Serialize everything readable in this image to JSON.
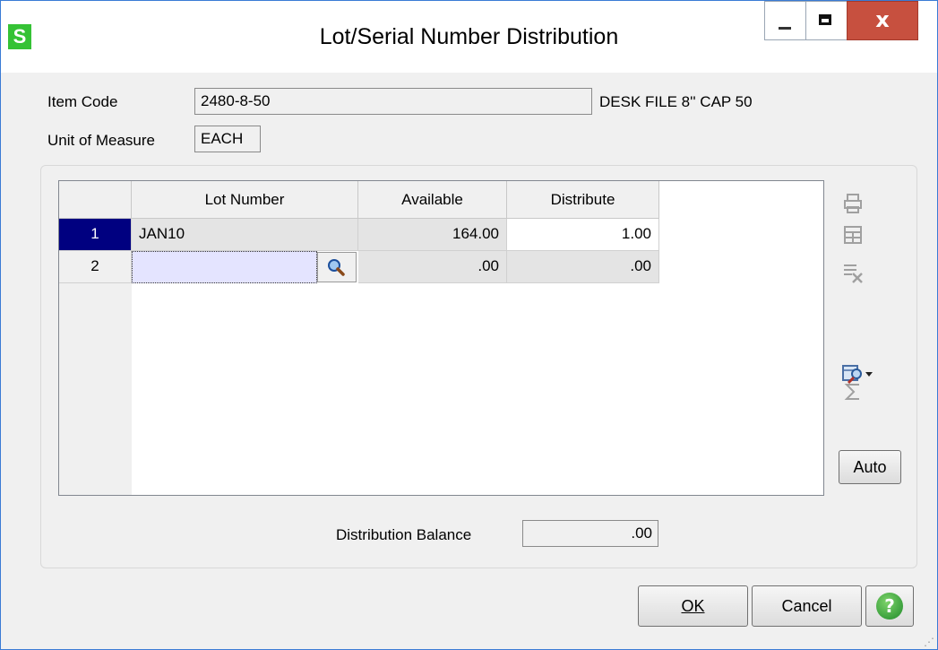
{
  "window": {
    "app_icon_letter": "S",
    "title": "Lot/Serial Number Distribution",
    "close_glyph": "x"
  },
  "form": {
    "item_code_label": "Item Code",
    "item_code_value": "2480-8-50",
    "item_description": "DESK FILE 8'' CAP 50",
    "uom_label": "Unit of Measure",
    "uom_value": "EACH"
  },
  "grid": {
    "columns": [
      "Lot Number",
      "Available",
      "Distribute"
    ],
    "rows": [
      {
        "num": "1",
        "lot": "JAN10",
        "available": "164.00",
        "distribute": "1.00"
      },
      {
        "num": "2",
        "lot": "",
        "available": ".00",
        "distribute": ".00"
      }
    ]
  },
  "toolbar": {
    "icons": [
      "print-icon",
      "grid-view-icon",
      "delete-row-icon",
      "customize-icon",
      "totals-icon"
    ],
    "auto_label": "Auto"
  },
  "balance": {
    "label": "Distribution Balance",
    "value": ".00"
  },
  "buttons": {
    "ok_label": "OK",
    "cancel_label": "Cancel",
    "help_glyph": "?"
  }
}
